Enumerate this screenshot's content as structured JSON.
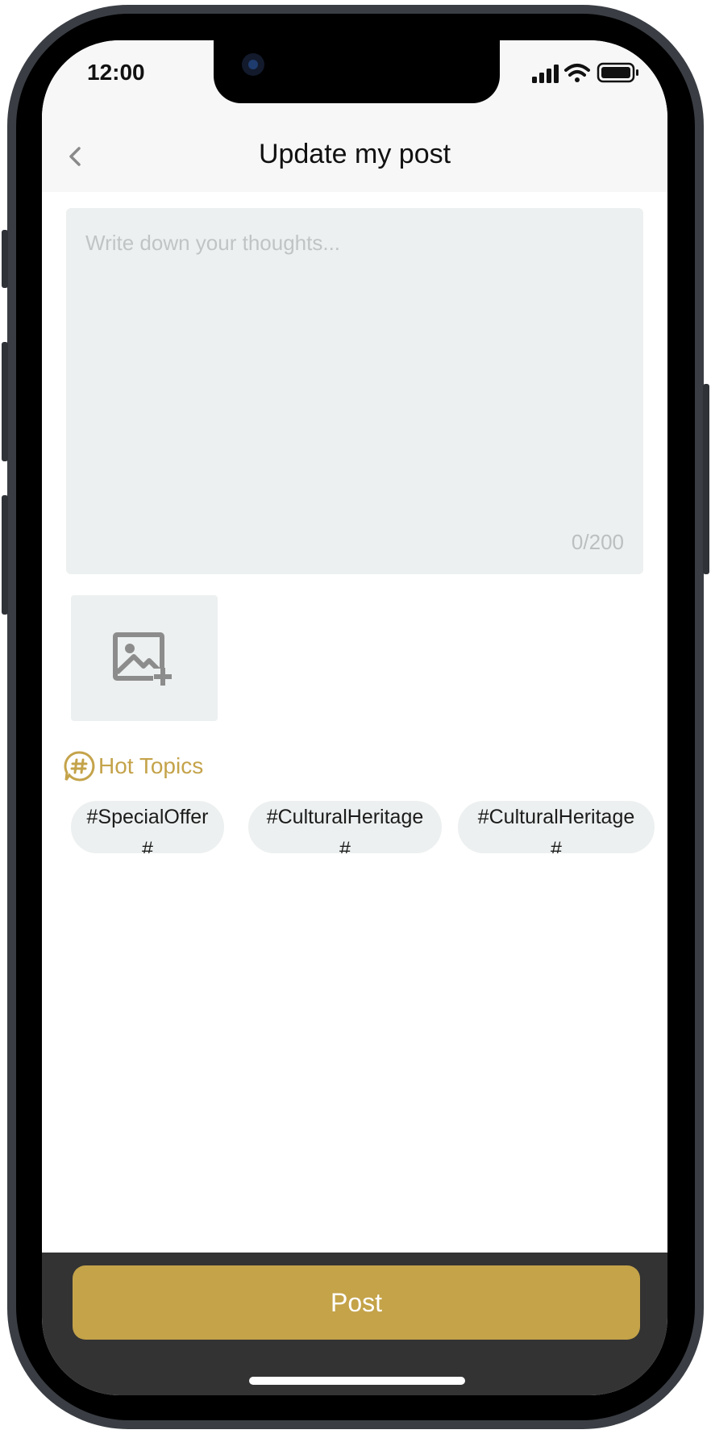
{
  "status_bar": {
    "time": "12:00"
  },
  "header": {
    "title": "Update my post"
  },
  "composer": {
    "placeholder": "Write down your thoughts...",
    "counter": "0/200"
  },
  "hot_topics": {
    "label": "Hot Topics",
    "chips": [
      {
        "line1": "#SpecialOffer",
        "line2": "#"
      },
      {
        "line1": "#CulturalHeritage",
        "line2": "#"
      },
      {
        "line1": "#CulturalHeritage",
        "line2": "#"
      }
    ]
  },
  "footer": {
    "post_label": "Post"
  },
  "colors": {
    "accent": "#c4a349",
    "footer_bg": "#333333",
    "field_bg": "#edf0f0"
  }
}
